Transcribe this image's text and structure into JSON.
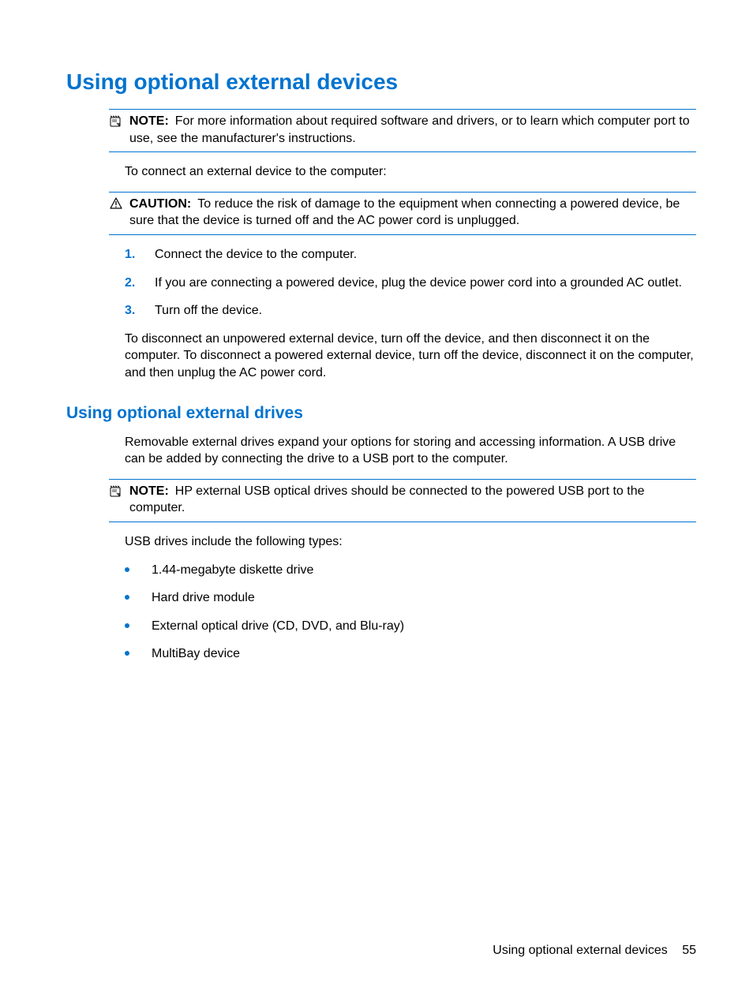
{
  "heading1": "Using optional external devices",
  "note1": {
    "label": "NOTE:",
    "text": "For more information about required software and drivers, or to learn which computer port to use, see the manufacturer's instructions."
  },
  "para_connect": "To connect an external device to the computer:",
  "caution1": {
    "label": "CAUTION:",
    "text": "To reduce the risk of damage to the equipment when connecting a powered device, be sure that the device is turned off and the AC power cord is unplugged."
  },
  "steps": {
    "s1": {
      "num": "1.",
      "text": "Connect the device to the computer."
    },
    "s2": {
      "num": "2.",
      "text": "If you are connecting a powered device, plug the device power cord into a grounded AC outlet."
    },
    "s3": {
      "num": "3.",
      "text": "Turn off the device."
    }
  },
  "para_disconnect": "To disconnect an unpowered external device, turn off the device, and then disconnect it on the computer. To disconnect a powered external device, turn off the device, disconnect it on the computer, and then unplug the AC power cord.",
  "heading2": "Using optional external drives",
  "para_removable": "Removable external drives expand your options for storing and accessing information. A USB drive can be added by connecting the drive to a USB port to the computer.",
  "note2": {
    "label": "NOTE:",
    "text": "HP external USB optical drives should be connected to the powered USB port to the computer."
  },
  "para_types": "USB drives include the following types:",
  "bullets": {
    "b1": "1.44-megabyte diskette drive",
    "b2": "Hard drive module",
    "b3": "External optical drive (CD, DVD, and Blu-ray)",
    "b4": "MultiBay device"
  },
  "footer": {
    "title": "Using optional external devices",
    "page": "55"
  }
}
